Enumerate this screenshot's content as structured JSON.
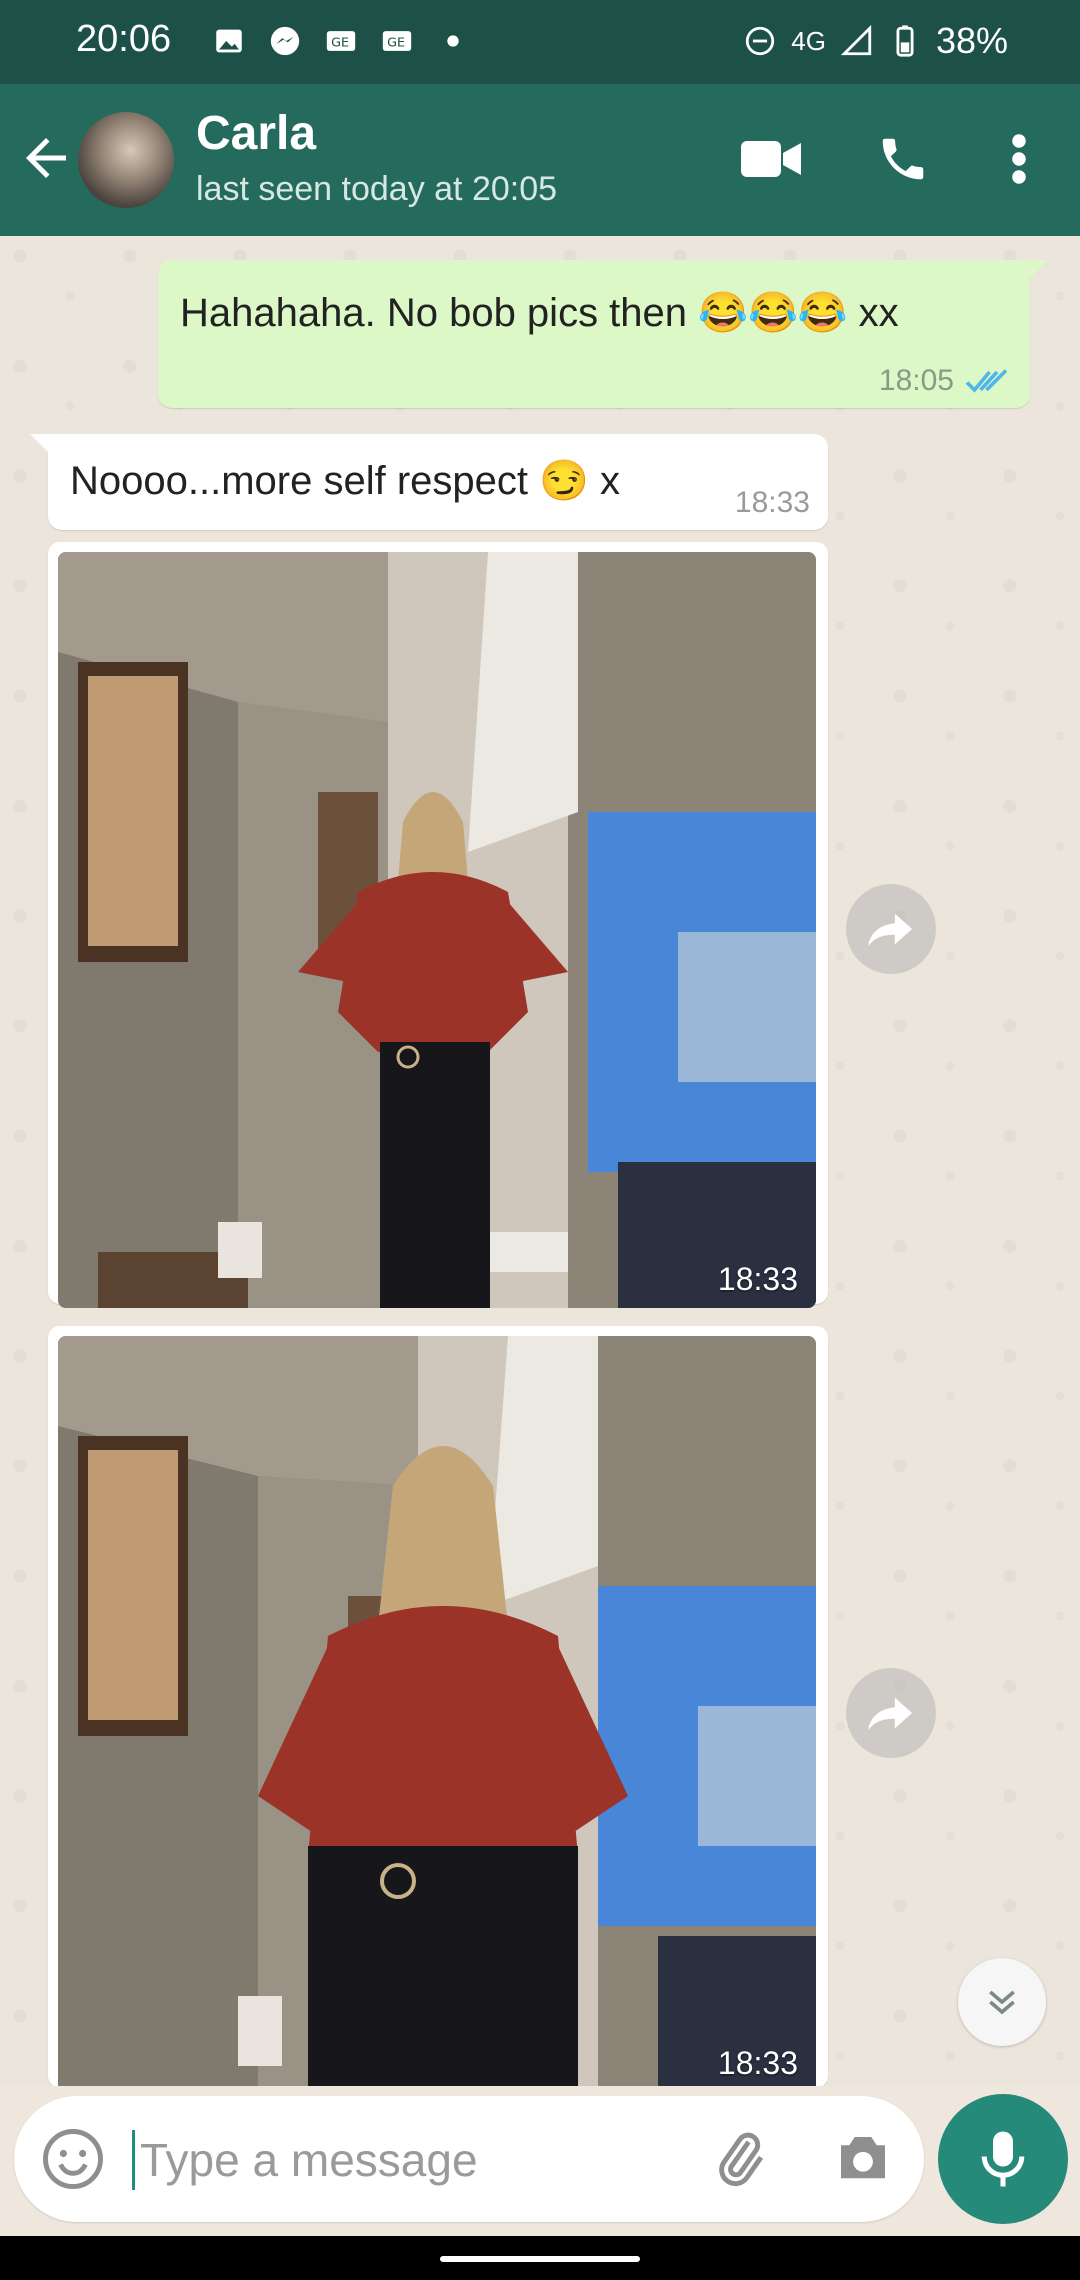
{
  "status_bar": {
    "time": "20:06",
    "network": "4G",
    "battery": "38%"
  },
  "header": {
    "contact_name": "Carla",
    "last_seen": "last seen today at 20:05",
    "icons": [
      "back-arrow-icon",
      "video-call-icon",
      "phone-icon",
      "more-vert-icon"
    ]
  },
  "messages": [
    {
      "direction": "outgoing",
      "text": "Hahahaha.  No bob pics then 😂😂😂 xx",
      "time": "18:05",
      "status": "read"
    },
    {
      "direction": "incoming",
      "text": "Noooo...more self respect 😏 x",
      "time": "18:33"
    },
    {
      "direction": "incoming",
      "type": "image",
      "time": "18:33"
    },
    {
      "direction": "incoming",
      "type": "image",
      "time": "18:33"
    }
  ],
  "composer": {
    "placeholder": "Type a message",
    "icons": [
      "emoji-icon",
      "attach-icon",
      "camera-icon",
      "mic-icon"
    ]
  },
  "colors": {
    "status_bar": "#1d5047",
    "app_bar": "#246a5d",
    "outgoing_bubble": "#dcf8c6",
    "incoming_bubble": "#ffffff",
    "accent": "#258a79"
  }
}
